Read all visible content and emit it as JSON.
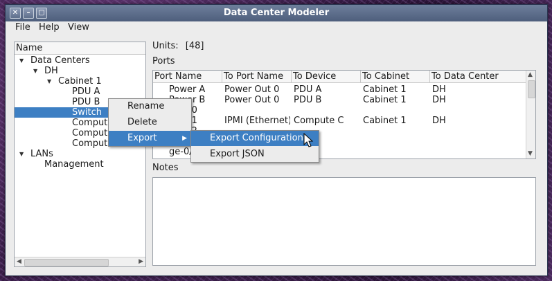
{
  "window": {
    "title": "Data Center Modeler"
  },
  "menubar": {
    "file": "File",
    "help": "Help",
    "view": "View"
  },
  "tree": {
    "header": "Name",
    "nodes": [
      {
        "label": "Data Centers",
        "expanded": true
      },
      {
        "label": "DH",
        "expanded": true
      },
      {
        "label": "Cabinet 1",
        "expanded": true
      },
      {
        "label": "PDU A"
      },
      {
        "label": "PDU B"
      },
      {
        "label": "Switch",
        "selected": true
      },
      {
        "label": "Compute"
      },
      {
        "label": "Compute"
      },
      {
        "label": "Compute"
      },
      {
        "label": "LANs",
        "expanded": true
      },
      {
        "label": "Management"
      }
    ]
  },
  "details": {
    "units_label": "Units:",
    "units_value": "[48]",
    "ports_label": "Ports",
    "notes_label": "Notes",
    "columns": [
      "Port Name",
      "To Port Name",
      "To Device",
      "To Cabinet",
      "To Data Center"
    ],
    "rows": [
      [
        "Power A",
        "Power Out 0",
        "PDU A",
        "Cabinet 1",
        "DH"
      ],
      [
        "Power B",
        "Power Out 0",
        "PDU B",
        "Cabinet 1",
        "DH"
      ],
      [
        "0/0",
        "",
        "",
        "",
        ""
      ],
      [
        "0/1",
        "IPMI (Ethernet)",
        "Compute C",
        "Cabinet 1",
        "DH"
      ],
      [
        "0/2",
        "",
        "",
        "",
        ""
      ],
      [
        "",
        "",
        "",
        "",
        ""
      ],
      [
        "ge-0/",
        "",
        "",
        "",
        ""
      ]
    ]
  },
  "context_menu": {
    "items": [
      "Rename",
      "Delete",
      "Export"
    ],
    "highlighted": "Export"
  },
  "submenu": {
    "items": [
      "Export Configuration",
      "Export JSON"
    ],
    "highlighted": "Export Configuration"
  },
  "colors": {
    "selection": "#3d7fc3",
    "titlebar": "#5e6e8c"
  }
}
